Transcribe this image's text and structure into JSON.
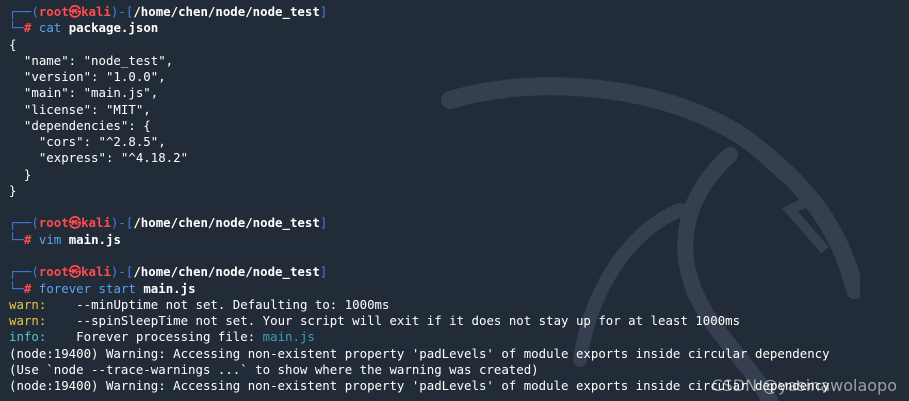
{
  "prompt": {
    "user": "root",
    "skull": "㉿",
    "host": "kali",
    "path": "/home/chen/node/node_test",
    "hash": "#"
  },
  "block1": {
    "cmd_name": "cat",
    "cmd_arg": "package.json",
    "json_lines": [
      "{",
      "  \"name\": \"node_test\",",
      "  \"version\": \"1.0.0\",",
      "  \"main\": \"main.js\",",
      "  \"license\": \"MIT\",",
      "  \"dependencies\": {",
      "    \"cors\": \"^2.8.5\",",
      "    \"express\": \"^4.18.2\"",
      "  }",
      "}"
    ]
  },
  "block2": {
    "cmd_name": "vim",
    "cmd_arg": "main.js"
  },
  "block3": {
    "cmd_name": "forever start",
    "cmd_arg": "main.js",
    "warn1_label": "warn:",
    "warn1_text": "    --minUptime not set. Defaulting to: 1000ms",
    "warn2_label": "warn:",
    "warn2_text": "    --spinSleepTime not set. Your script will exit if it does not stay up for at least 1000ms",
    "info_label": "info:",
    "info_text": "    Forever processing file: ",
    "info_file": "main.js",
    "node_warn1": "(node:19400) Warning: Accessing non-existent property 'padLevels' of module exports inside circular dependency",
    "node_hint": "(Use `node --trace-warnings ...` to show where the warning was created)",
    "node_warn2": "(node:19400) Warning: Accessing non-existent property 'padLevels' of module exports inside circular dependency"
  },
  "watermark": "CSDN @yasinawolaopo",
  "colors": {
    "background": "#222b38",
    "prompt_frame": "#3f7fe6",
    "prompt_user": "#ff4c4c",
    "warn": "#e6c84a",
    "info": "#4fc4cf"
  }
}
